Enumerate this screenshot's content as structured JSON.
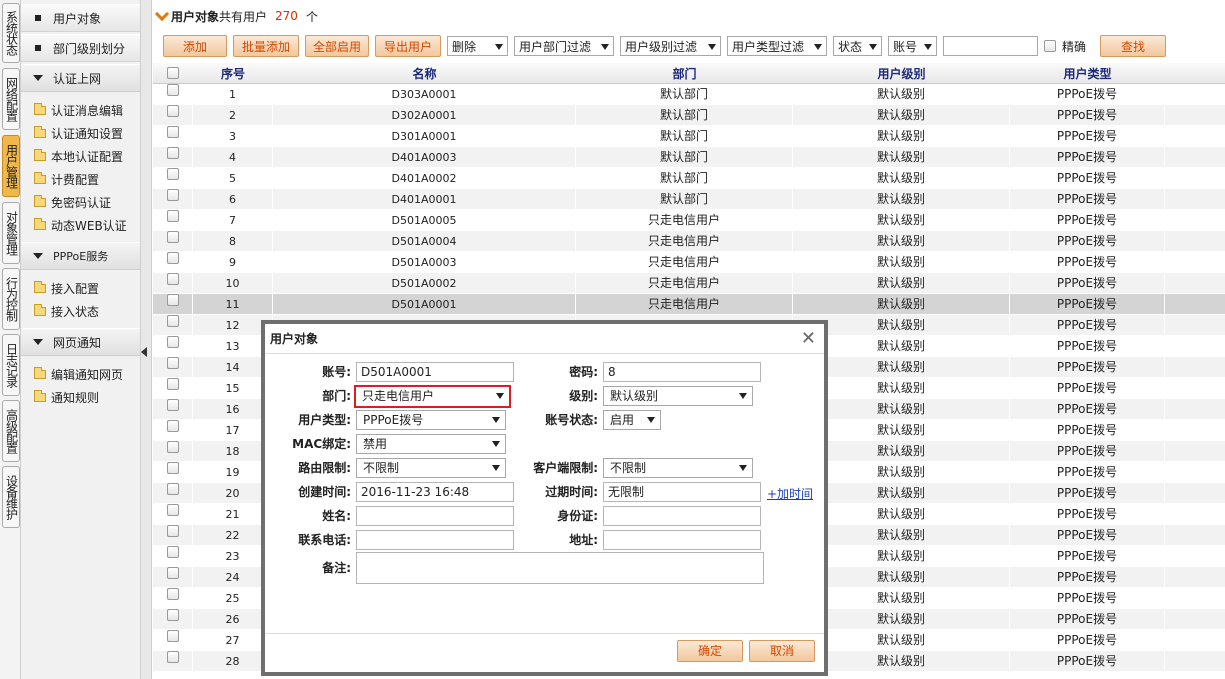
{
  "vtabs": [
    "系统状态",
    "网络配置",
    "用户管理",
    "对象管理",
    "行为控制",
    "日志记录",
    "高级配置",
    "设备维护"
  ],
  "sidebar": {
    "top_items": [
      "用户对象",
      "部门级别划分"
    ],
    "groups": [
      {
        "label": "认证上网",
        "items": [
          "认证消息编辑",
          "认证通知设置",
          "本地认证配置",
          "计费配置",
          "免密码认证",
          "动态WEB认证"
        ]
      },
      {
        "label": "PPPoE服务",
        "items": [
          "接入配置",
          "接入状态"
        ]
      },
      {
        "label": "网页通知",
        "items": [
          "编辑通知网页",
          "通知规则"
        ]
      }
    ]
  },
  "header": {
    "title": "用户对象",
    "suffix": "共有用户",
    "count": "270",
    "unit": "个"
  },
  "toolbar": {
    "buttons": [
      "添加",
      "批量添加",
      "全部启用",
      "导出用户"
    ],
    "selects": [
      "删除",
      "用户部门过滤",
      "用户级别过滤",
      "用户类型过滤",
      "状态",
      "账号"
    ],
    "exact_label": "精确",
    "search_label": "查找"
  },
  "table": {
    "columns": [
      "序号",
      "名称",
      "部门",
      "用户级别",
      "用户类型"
    ],
    "rows": [
      [
        "1",
        "D303A0001",
        "默认部门",
        "默认级别",
        "PPPoE拨号"
      ],
      [
        "2",
        "D302A0001",
        "默认部门",
        "默认级别",
        "PPPoE拨号"
      ],
      [
        "3",
        "D301A0001",
        "默认部门",
        "默认级别",
        "PPPoE拨号"
      ],
      [
        "4",
        "D401A0003",
        "默认部门",
        "默认级别",
        "PPPoE拨号"
      ],
      [
        "5",
        "D401A0002",
        "默认部门",
        "默认级别",
        "PPPoE拨号"
      ],
      [
        "6",
        "D401A0001",
        "默认部门",
        "默认级别",
        "PPPoE拨号"
      ],
      [
        "7",
        "D501A0005",
        "只走电信用户",
        "默认级别",
        "PPPoE拨号"
      ],
      [
        "8",
        "D501A0004",
        "只走电信用户",
        "默认级别",
        "PPPoE拨号"
      ],
      [
        "9",
        "D501A0003",
        "只走电信用户",
        "默认级别",
        "PPPoE拨号"
      ],
      [
        "10",
        "D501A0002",
        "只走电信用户",
        "默认级别",
        "PPPoE拨号"
      ],
      [
        "11",
        "D501A0001",
        "只走电信用户",
        "默认级别",
        "PPPoE拨号"
      ],
      [
        "12",
        "",
        "",
        "默认级别",
        "PPPoE拨号"
      ],
      [
        "13",
        "",
        "",
        "默认级别",
        "PPPoE拨号"
      ],
      [
        "14",
        "",
        "",
        "默认级别",
        "PPPoE拨号"
      ],
      [
        "15",
        "",
        "",
        "默认级别",
        "PPPoE拨号"
      ],
      [
        "16",
        "",
        "",
        "默认级别",
        "PPPoE拨号"
      ],
      [
        "17",
        "",
        "",
        "默认级别",
        "PPPoE拨号"
      ],
      [
        "18",
        "",
        "",
        "默认级别",
        "PPPoE拨号"
      ],
      [
        "19",
        "",
        "",
        "默认级别",
        "PPPoE拨号"
      ],
      [
        "20",
        "",
        "",
        "默认级别",
        "PPPoE拨号"
      ],
      [
        "21",
        "",
        "",
        "默认级别",
        "PPPoE拨号"
      ],
      [
        "22",
        "",
        "",
        "默认级别",
        "PPPoE拨号"
      ],
      [
        "23",
        "",
        "",
        "默认级别",
        "PPPoE拨号"
      ],
      [
        "24",
        "",
        "",
        "默认级别",
        "PPPoE拨号"
      ],
      [
        "25",
        "",
        "",
        "默认级别",
        "PPPoE拨号"
      ],
      [
        "26",
        "",
        "",
        "默认级别",
        "PPPoE拨号"
      ],
      [
        "27",
        "",
        "",
        "默认级别",
        "PPPoE拨号"
      ],
      [
        "28",
        "",
        "",
        "默认级别",
        "PPPoE拨号"
      ]
    ],
    "selected_row": "11"
  },
  "modal": {
    "title": "用户对象",
    "labels": {
      "account": "账号:",
      "password": "密码:",
      "dept": "部门:",
      "level": "级别:",
      "user_type": "用户类型:",
      "account_status": "账号状态:",
      "mac": "MAC绑定:",
      "route": "路由限制:",
      "client": "客户端限制:",
      "created": "创建时间:",
      "expire": "过期时间:",
      "name": "姓名:",
      "id_card": "身份证:",
      "phone": "联系电话:",
      "address": "地址:",
      "remark": "备注:"
    },
    "values": {
      "account": "D501A0001",
      "password": "8",
      "dept": "只走电信用户",
      "level": "默认级别",
      "user_type": "PPPoE拨号",
      "account_status": "启用",
      "mac": "禁用",
      "route": "不限制",
      "client": "不限制",
      "created": "2016-11-23 16:48",
      "expire": "无限制",
      "name": "",
      "id_card": "",
      "phone": "",
      "address": "",
      "remark": ""
    },
    "add_time_link": "+加时间",
    "ok_label": "确定",
    "cancel_label": "取消"
  }
}
